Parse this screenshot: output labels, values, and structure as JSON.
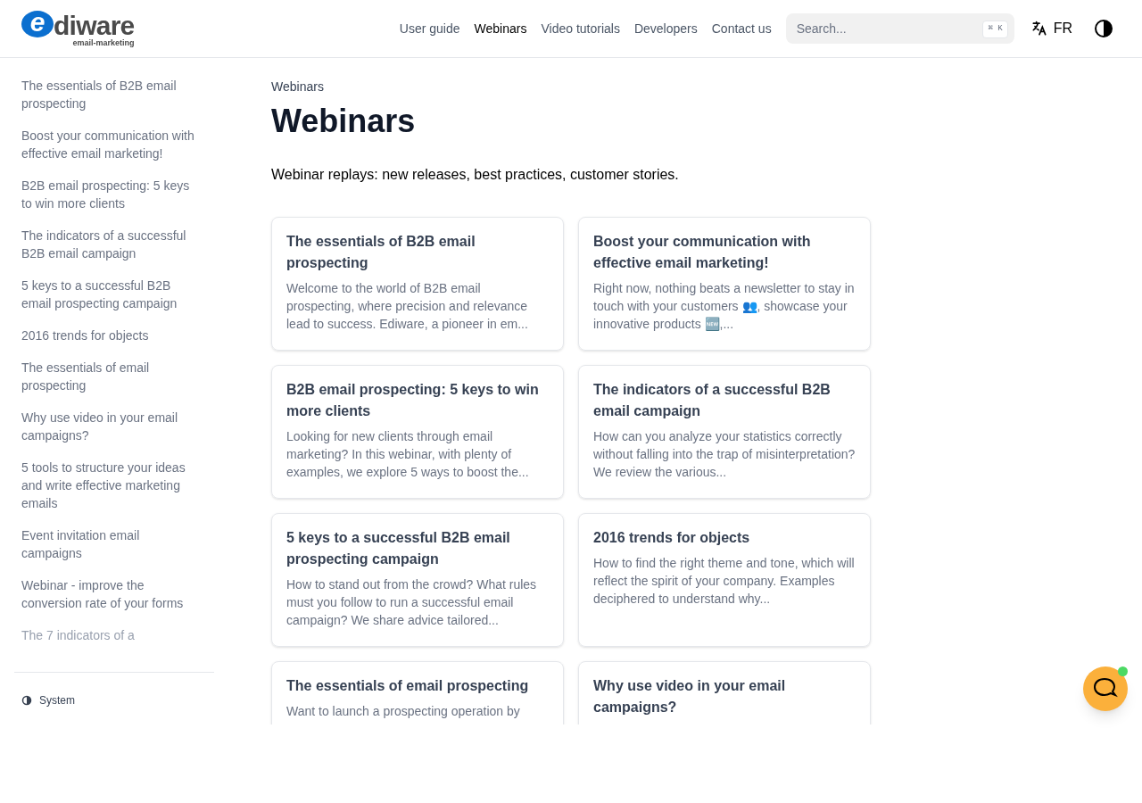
{
  "logo": {
    "mark": "e",
    "name": "diware",
    "tagline": "email-marketing"
  },
  "nav": [
    {
      "label": "User guide",
      "selected": false
    },
    {
      "label": "Webinars",
      "selected": true
    },
    {
      "label": "Video tutorials",
      "selected": false
    },
    {
      "label": "Developers",
      "selected": false
    },
    {
      "label": "Contact us",
      "selected": false
    }
  ],
  "search": {
    "placeholder": "Search...",
    "shortcut": "⌘ K"
  },
  "language": "FR",
  "sidebar": {
    "items": [
      {
        "label": "The essentials of B2B email prospecting"
      },
      {
        "label": "Boost your communication with effective email marketing!"
      },
      {
        "label": "B2B email prospecting: 5 keys to win more clients"
      },
      {
        "label": "The indicators of a successful B2B email campaign"
      },
      {
        "label": "5 keys to a successful B2B email prospecting campaign"
      },
      {
        "label": "2016 trends for objects"
      },
      {
        "label": "The essentials of email prospecting"
      },
      {
        "label": "Why use video in your email campaigns?"
      },
      {
        "label": "5 tools to structure your ideas and write effective marketing emails"
      },
      {
        "label": "Event invitation email campaigns"
      },
      {
        "label": "Webinar - improve the conversion rate of your forms"
      },
      {
        "label": "The 7 indicators of a"
      }
    ],
    "theme": "System"
  },
  "breadcrumb": "Webinars",
  "title": "Webinars",
  "intro": "Webinar replays: new releases, best practices, customer stories.",
  "cards": [
    {
      "title": "The essentials of B2B email prospecting",
      "description": "Welcome to the world of B2B email prospecting, where precision and relevance lead to success. Ediware, a pioneer in em..."
    },
    {
      "title": "Boost your communication with effective email marketing!",
      "description": "Right now, nothing beats a newsletter to stay in touch with your customers 👥, showcase your innovative products 🆕,..."
    },
    {
      "title": "B2B email prospecting: 5 keys to win more clients",
      "description": "Looking for new clients through email marketing? In this webinar, with plenty of examples, we explore 5 ways to boost the..."
    },
    {
      "title": "The indicators of a successful B2B email campaign",
      "description": "How can you analyze your statistics correctly without falling into the trap of misinterpretation? We review the various..."
    },
    {
      "title": "5 keys to a successful B2B email prospecting campaign",
      "description": "How to stand out from the crowd? What rules must you follow to run a successful email campaign? We share advice tailored..."
    },
    {
      "title": "2016 trends for objects",
      "description": "How to find the right theme and tone, which will reflect the spirit of your company. Examples deciphered to understand why..."
    },
    {
      "title": "The essentials of email prospecting",
      "description": "Want to launch a prospecting operation by"
    },
    {
      "title": "Why use video in your email campaigns?"
    }
  ]
}
